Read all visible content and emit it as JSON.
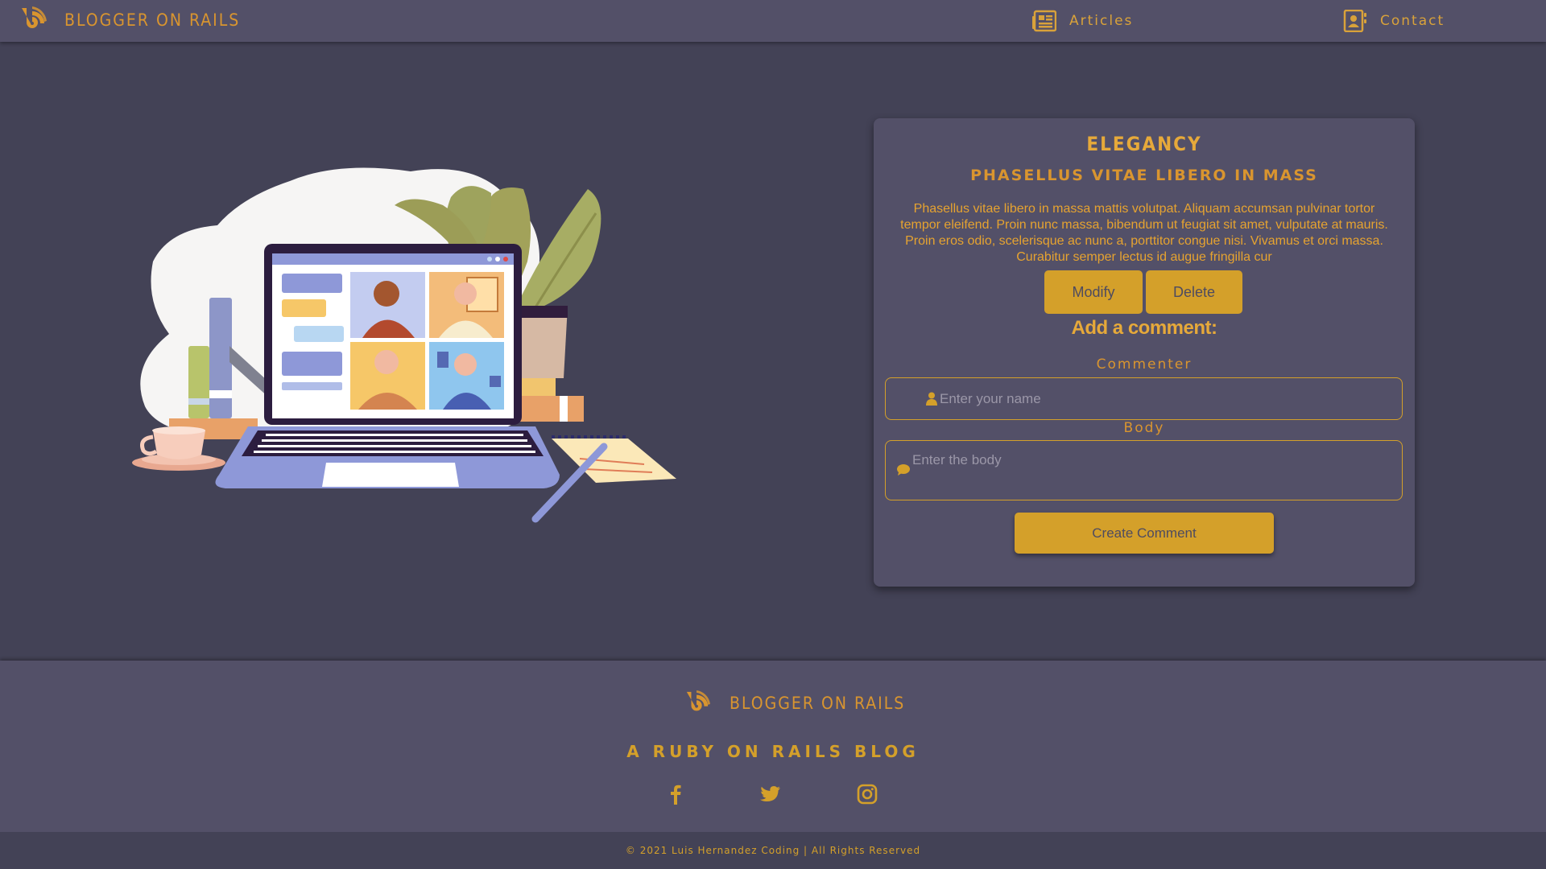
{
  "navbar": {
    "brand": "BLOGGER ON RAILS",
    "links": [
      {
        "label": "Articles",
        "icon": "newspaper-icon"
      },
      {
        "label": "Contact",
        "icon": "address-book-icon"
      }
    ]
  },
  "hero": {
    "icon": "laptop-video-call-illustration"
  },
  "article": {
    "title": "ELEGANCY",
    "subtitle": "PHASELLUS VITAE LIBERO IN MASS",
    "body": "Phasellus vitae libero in massa mattis volutpat. Aliquam accumsan pulvinar tortor tempor eleifend. Proin nunc massa, bibendum ut feugiat sit amet, vulputate at mauris. Proin eros odio, scelerisque ac nunc a, porttitor congue nisi. Vivamus et orci massa. Curabitur semper lectus id augue fringilla cur",
    "modify_label": "Modify",
    "delete_label": "Delete"
  },
  "comment_form": {
    "heading": "Add a comment:",
    "commenter_label": "Commenter",
    "commenter_placeholder": "Enter your name",
    "body_label": "Body",
    "body_placeholder": "Enter the body",
    "submit_label": "Create Comment"
  },
  "footer": {
    "brand": "BLOGGER ON RAILS",
    "tagline": "A RUBY ON RAILS BLOG",
    "social": [
      "facebook-icon",
      "twitter-icon",
      "instagram-icon"
    ],
    "copyright": "© 2021 Luis Hernandez Coding | All Rights Reserved"
  },
  "colors": {
    "background": "#434256",
    "panel": "#535068",
    "accent": "#d4a02a"
  }
}
